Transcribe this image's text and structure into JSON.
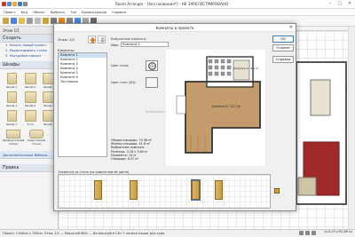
{
  "window": {
    "title": "Room Arranger - [без названия*] - НЕ ЗАРЕГИСТРИРОВАНО"
  },
  "menu": [
    "Проект",
    "Вид",
    "Объект",
    "Выбрать",
    "Тип",
    "Конфигурация",
    "Справка"
  ],
  "left_panel": {
    "floor_label": "Этаж  1/1",
    "create_title": "Создать",
    "steps": [
      "1. Начать новый проект",
      "2. Редактировать стены",
      "3. Настройка комнат"
    ],
    "category": "Шкафы",
    "furniture": [
      {
        "label": "Шкаф 1"
      },
      {
        "label": "Шкаф 2"
      },
      {
        "label": "Шкаф 3"
      },
      {
        "label": "Шкаф 1"
      },
      {
        "label": "Шкаф 2"
      },
      {
        "label": "Шкаф 3"
      },
      {
        "label": "Шкаф 1"
      },
      {
        "label": "Угол"
      },
      {
        "label": "Шкаф 2"
      }
    ],
    "furniture2": [
      {
        "label": "Прямоугольная полка"
      },
      {
        "label": "Скругленная полка"
      }
    ],
    "more_label": "Дополнительные библио...",
    "rules_title": "Правка"
  },
  "dialog": {
    "title": "Комнаты в проекте",
    "floor_label": "Этаж:  1/1",
    "rooms_label": "Комнаты:",
    "rooms": [
      "Комната 1",
      "Комната 2",
      "Комната 3",
      "Комната 4",
      "Комната 5",
      "Комната 6",
      "Экстерьер"
    ],
    "selected_room_index": 0,
    "props_title": "Выбранные комнаты",
    "name_label": "Имя:",
    "name_value": "Комната 1",
    "floor_color_label": "Цвет пола:",
    "wall_color_label": "Цвет стен (3D):",
    "wallpaper_label": "Выбранные стены",
    "stats": [
      "Общая площадь: 74.36 м²",
      "Жилая площадь: 41.6 м²",
      "Выбранные комнаты:",
      "Размеры: 3.18 x 3.84 м",
      "Периметр: 14 м",
      "Площадь: 8.37 м²"
    ],
    "plan_labels": {
      "room_top": "Комната 2 / 4.1 м²",
      "room_big": "Комната 6 / 42.3 м²"
    },
    "buttons": {
      "ok": "OK",
      "cancel": "Отмена",
      "help": "Справка"
    },
    "wall_section_label": "Элементы на стене (на комнатном её цвете)"
  },
  "status": {
    "left": "Проект 1160см x 785см, Этаж 1/2 — Масштаб 86% — Используйте Ctrl + колесо мыши для зума",
    "right": "(x:4.29 y:92.88 м)"
  },
  "colors": {
    "accent": "#2d6fd0",
    "floor_wood": "#c49b6c",
    "room_red": "#a02a2a"
  }
}
